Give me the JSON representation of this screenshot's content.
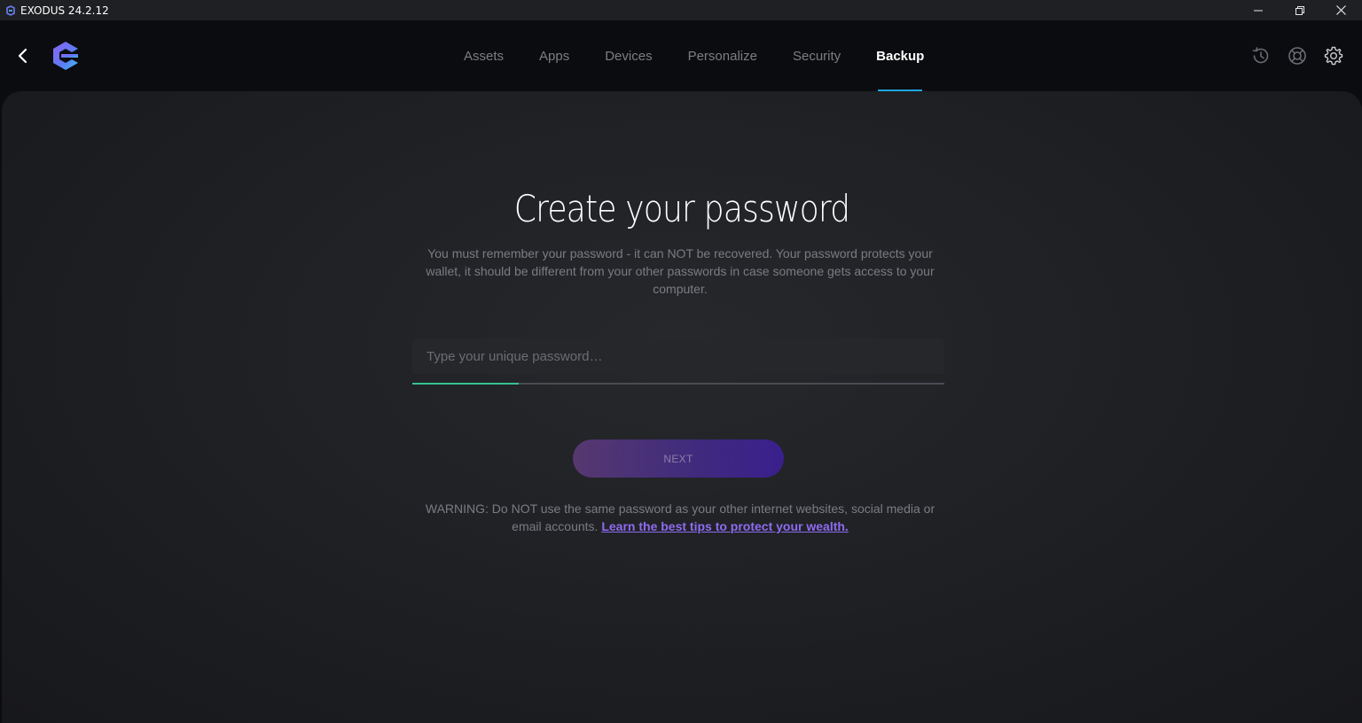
{
  "window": {
    "title": "EXODUS 24.2.12"
  },
  "nav": {
    "tabs": [
      {
        "label": "Assets",
        "active": false
      },
      {
        "label": "Apps",
        "active": false
      },
      {
        "label": "Devices",
        "active": false
      },
      {
        "label": "Personalize",
        "active": false
      },
      {
        "label": "Security",
        "active": false
      },
      {
        "label": "Backup",
        "active": true
      }
    ],
    "icons": [
      "history-icon",
      "support-icon",
      "settings-icon"
    ]
  },
  "main": {
    "title": "Create your password",
    "description": "You must remember your password - it can NOT be recovered. Your password protects your wallet, it should be different from your other passwords in case someone gets access to your computer.",
    "password_field": {
      "value": "",
      "placeholder": "Type your unique password…"
    },
    "password_strength": 0.2,
    "next_label": "NEXT",
    "warning_text": "WARNING: Do NOT use the same password as your other internet websites, social media or email accounts. ",
    "warning_link": "Learn the best tips to protect your wealth."
  },
  "colors": {
    "accent": "#1fa5e3",
    "strength": "#35c38f",
    "link": "#8f6bf0",
    "button_start": "#56386f",
    "button_end": "#3a1f8d"
  }
}
